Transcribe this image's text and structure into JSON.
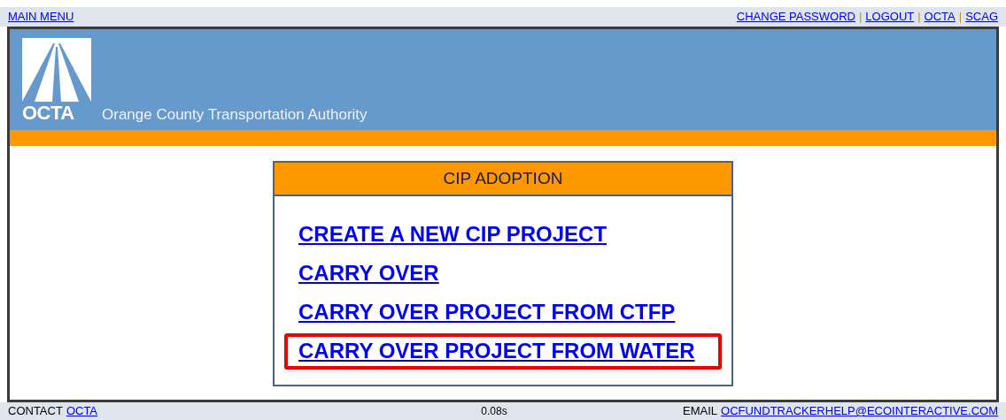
{
  "top_bar": {
    "left_links": [
      "MAIN MENU"
    ],
    "right_links": [
      "CHANGE PASSWORD",
      "LOGOUT",
      "OCTA",
      "SCAG"
    ],
    "separator": "|"
  },
  "header": {
    "logo_text": "OCTA",
    "agency_name": "Orange County Transportation Authority"
  },
  "panel": {
    "title": "CIP ADOPTION",
    "links": [
      {
        "label": "CREATE A NEW CIP PROJECT",
        "highlighted": false
      },
      {
        "label": "CARRY OVER",
        "highlighted": false
      },
      {
        "label": "CARRY OVER PROJECT FROM CTFP",
        "highlighted": false
      },
      {
        "label": "CARRY OVER PROJECT FROM WATER",
        "highlighted": true
      }
    ]
  },
  "footer": {
    "contact_label": "CONTACT",
    "contact_link": "OCTA",
    "timing": "0.08s",
    "email_label": "EMAIL",
    "email_link": "OCFUNDTRACKERHELP@ECOINTERACTIVE.COM"
  }
}
